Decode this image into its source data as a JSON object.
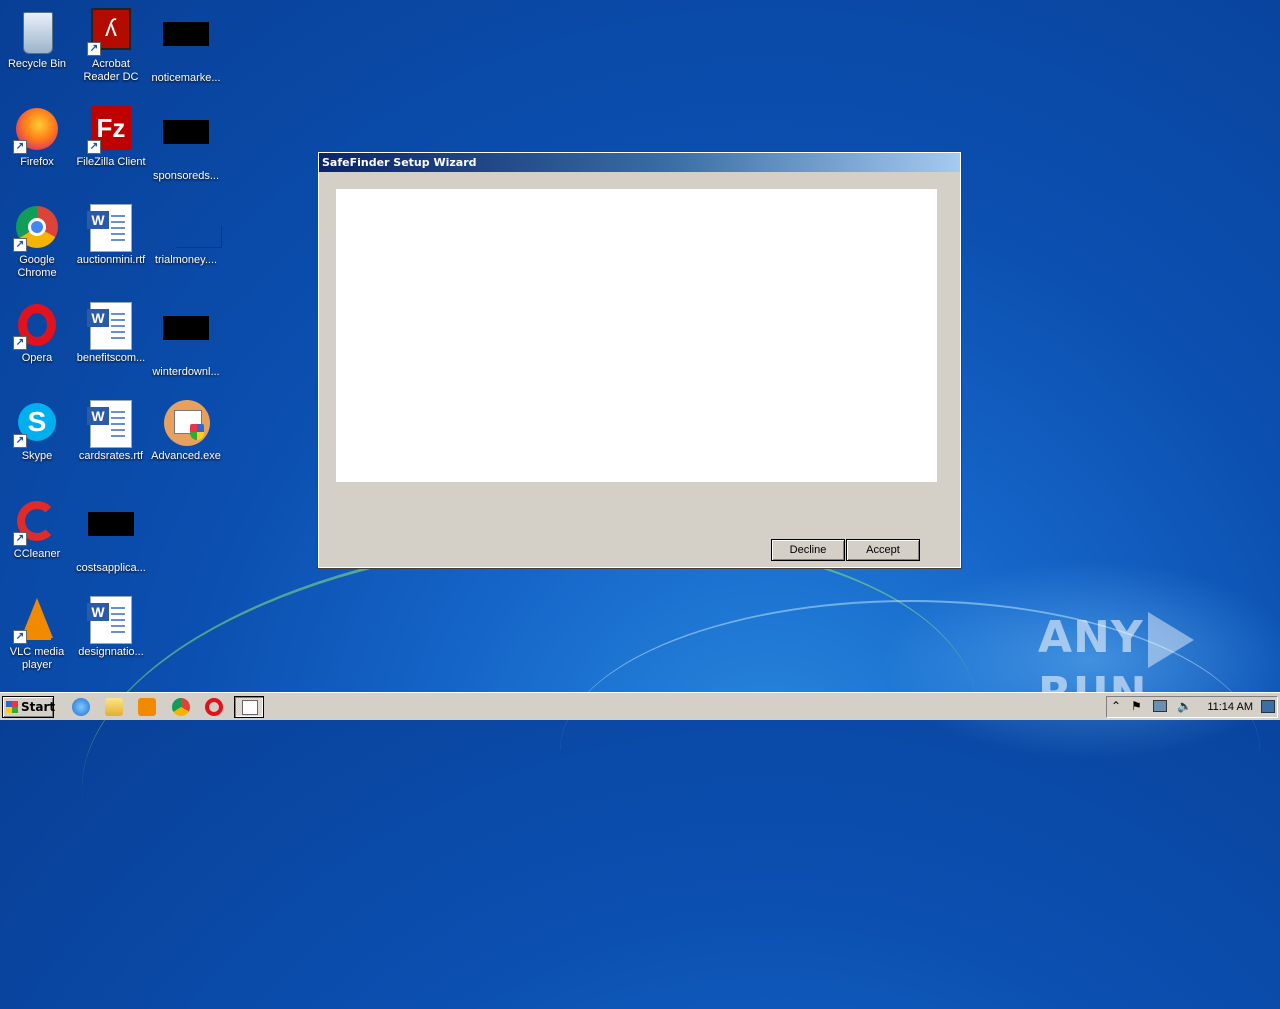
{
  "desktop": {
    "icons": [
      {
        "label": "Recycle Bin",
        "icon": "recycle-bin-icon"
      },
      {
        "label": "Acrobat Reader DC",
        "icon": "acrobat-icon"
      },
      {
        "label": "noticemarke...",
        "icon": "redacted-file-icon"
      },
      {
        "label": "Firefox",
        "icon": "firefox-icon"
      },
      {
        "label": "FileZilla Client",
        "icon": "filezilla-icon"
      },
      {
        "label": "sponsoreds...",
        "icon": "redacted-file-icon"
      },
      {
        "label": "Google Chrome",
        "icon": "chrome-icon"
      },
      {
        "label": "auctionmini.rtf",
        "icon": "word-doc-icon"
      },
      {
        "label": "trialmoney....",
        "icon": "blank-file-icon"
      },
      {
        "label": "Opera",
        "icon": "opera-icon"
      },
      {
        "label": "benefitscom...",
        "icon": "word-doc-icon"
      },
      {
        "label": "winterdownl...",
        "icon": "redacted-file-icon"
      },
      {
        "label": "Skype",
        "icon": "skype-icon"
      },
      {
        "label": "cardsrates.rtf",
        "icon": "word-doc-icon"
      },
      {
        "label": "Advanced.exe",
        "icon": "installer-icon"
      },
      {
        "label": "CCleaner",
        "icon": "ccleaner-icon"
      },
      {
        "label": "costsapplica...",
        "icon": "redacted-file-icon"
      },
      {
        "label": "VLC media player",
        "icon": "vlc-icon"
      },
      {
        "label": "designnatio...",
        "icon": "word-doc-icon"
      }
    ]
  },
  "dialog": {
    "title": "SafeFinder Setup Wizard",
    "decline_label": "Decline",
    "accept_label": "Accept"
  },
  "taskbar": {
    "start_label": "Start",
    "clock": "11:14 AM",
    "tray_icons": [
      "chevron-up-icon",
      "flag-icon",
      "network-icon",
      "speaker-icon"
    ]
  },
  "watermark": {
    "left": "ANY",
    "right": "RUN"
  },
  "colors": {
    "title_gradient_start": "#0a246a",
    "title_gradient_end": "#a6caf0",
    "dialog_bg": "#d4d0c8"
  }
}
